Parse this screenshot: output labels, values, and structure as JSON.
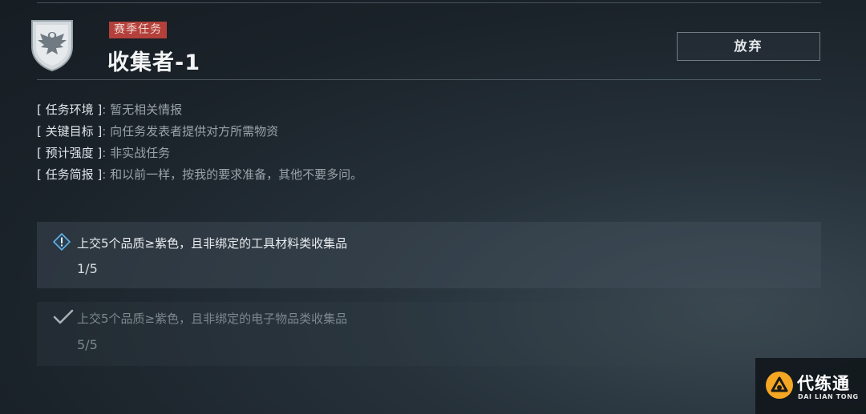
{
  "header": {
    "badge": "赛季任务",
    "title": "收集者-1",
    "abandon_label": "放弃"
  },
  "info": [
    {
      "label": "[ 任务环境 ]",
      "sep": ":",
      "value": "暂无相关情报"
    },
    {
      "label": "[ 关键目标 ]",
      "sep": ":",
      "value": "向任务发表者提供对方所需物资"
    },
    {
      "label": "[ 预计强度 ]",
      "sep": ":",
      "value": "非实战任务"
    },
    {
      "label": "[ 任务简报 ]",
      "sep": ":",
      "value": "和以前一样，按我的要求准备，其他不要多问。"
    }
  ],
  "objectives": [
    {
      "text": "上交5个品质≥紫色，且非绑定的工具材料类收集品",
      "progress": "1/5",
      "status": "in-progress",
      "icon": "alert-diamond-icon"
    },
    {
      "text": "上交5个品质≥紫色，且非绑定的电子物品类收集品",
      "progress": "5/5",
      "status": "completed",
      "icon": "checkmark-icon"
    }
  ],
  "watermark": {
    "name": "代练通",
    "subtitle": "DAI LIAN TONG"
  },
  "colors": {
    "badge_red": "#b3403a",
    "watermark_orange": "#f5a623",
    "alert_blue": "#5fb3e6"
  }
}
